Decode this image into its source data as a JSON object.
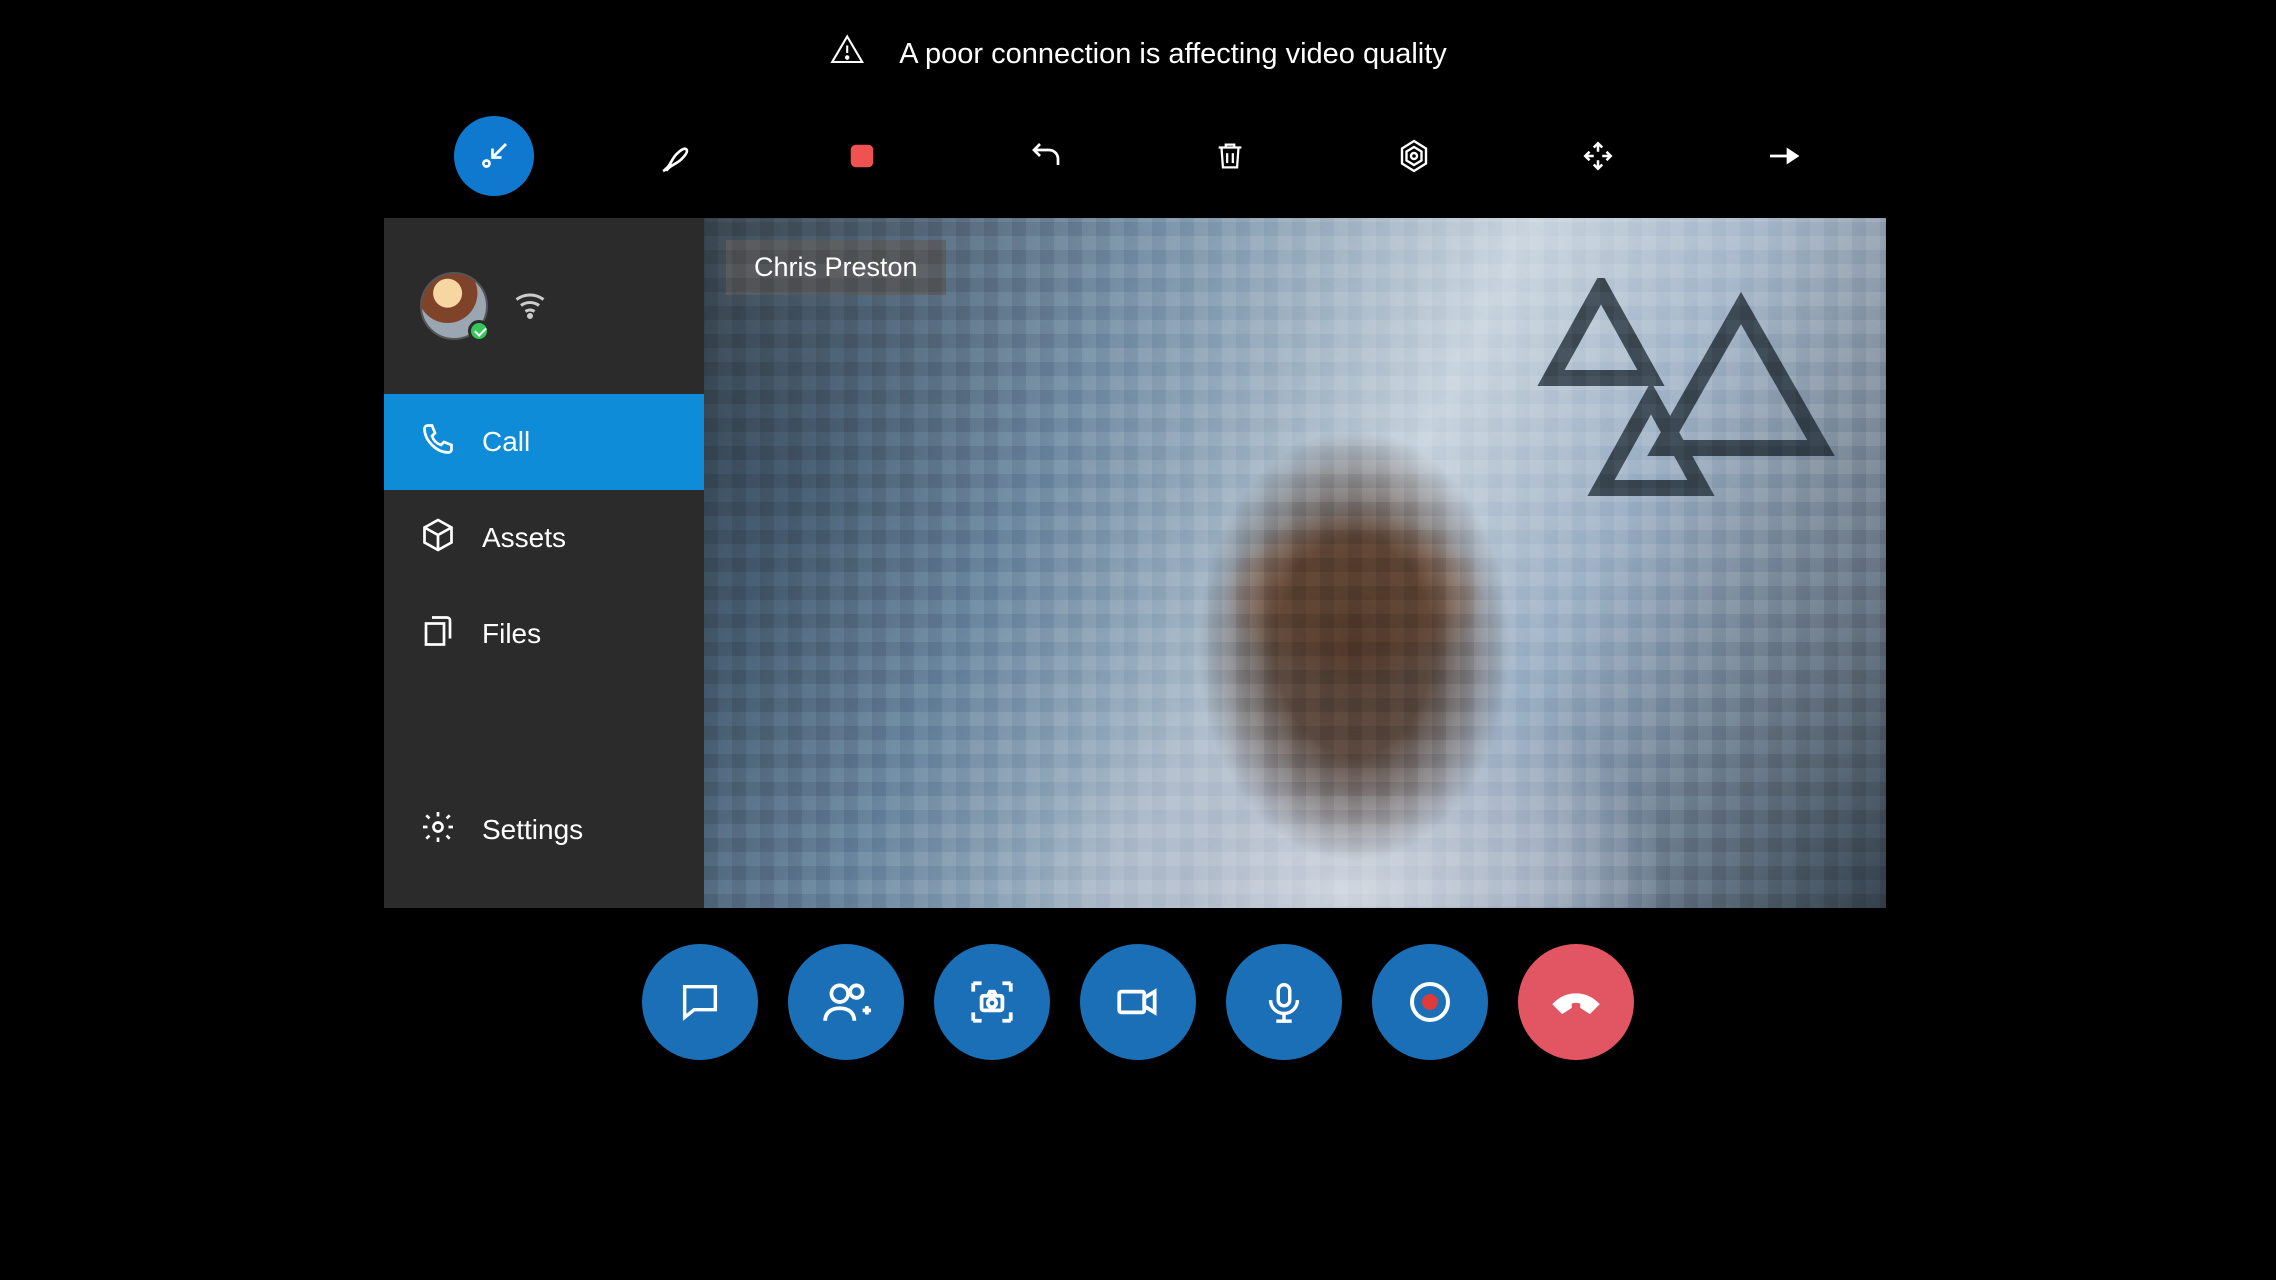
{
  "warning": {
    "text": "A poor connection is affecting video quality"
  },
  "toolbar": {
    "items": [
      {
        "name": "collapse-icon"
      },
      {
        "name": "pen-icon"
      },
      {
        "name": "record-square-icon"
      },
      {
        "name": "undo-icon"
      },
      {
        "name": "trash-icon"
      },
      {
        "name": "settings-hex-icon"
      },
      {
        "name": "expand-icon"
      },
      {
        "name": "pin-icon"
      }
    ]
  },
  "sidebar": {
    "items": [
      {
        "label": "Call"
      },
      {
        "label": "Assets"
      },
      {
        "label": "Files"
      },
      {
        "label": "Settings"
      }
    ]
  },
  "participant": {
    "name": "Chris Preston"
  },
  "colors": {
    "accent": "#0f8cd8",
    "toolbarActive": "#0f79d0",
    "callButton": "#1a6fb6",
    "endCall": "#e25563",
    "record": "#f05252"
  }
}
